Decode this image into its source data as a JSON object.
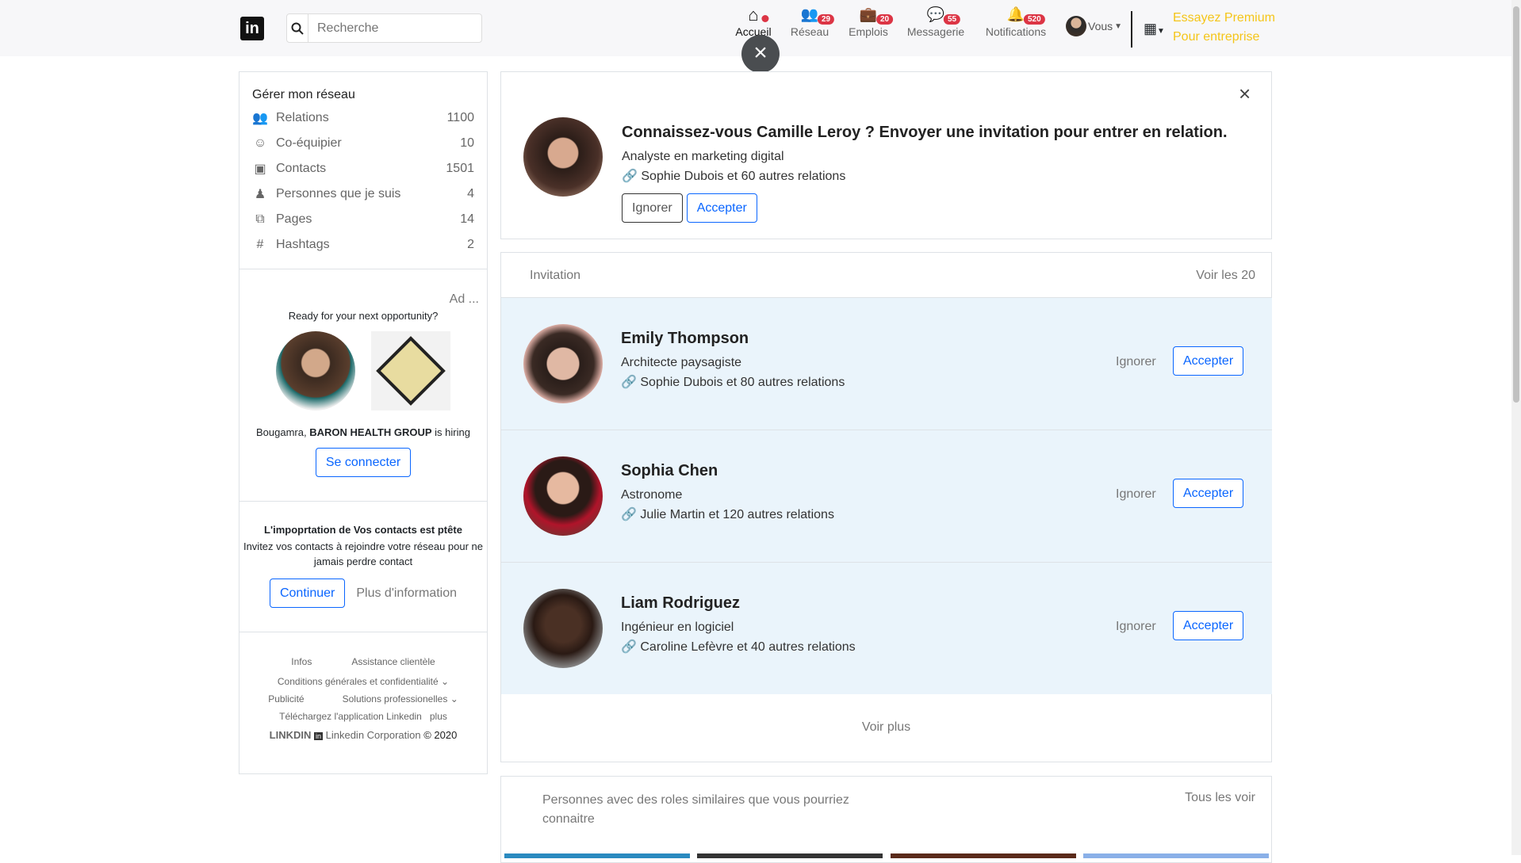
{
  "header": {
    "logo": "in",
    "search_placeholder": "Recherche",
    "nav": [
      {
        "label": "Accueil",
        "badge": ""
      },
      {
        "label": "Réseau",
        "badge": "29"
      },
      {
        "label": "Emplois",
        "badge": "20"
      },
      {
        "label": "Messagerie",
        "badge": "55"
      },
      {
        "label": "Notifications",
        "badge": "520"
      }
    ],
    "me": "Vous",
    "premium_1": "Essayez Premium",
    "premium_2": "Pour entreprise",
    "close": "×"
  },
  "sidebar": {
    "title": "Gérer mon réseau",
    "items": [
      {
        "label": "Relations",
        "count": "1100"
      },
      {
        "label": "Co-équipier",
        "count": "10"
      },
      {
        "label": "Contacts",
        "count": "1501"
      },
      {
        "label": "Personnes que je suis",
        "count": "4"
      },
      {
        "label": "Pages",
        "count": "14"
      },
      {
        "label": "Hashtags",
        "count": "2"
      }
    ],
    "ad": {
      "tag": "Ad ...",
      "headline": "Ready for your next opportunity?",
      "who": "Bougamra,",
      "company": "BARON HEALTH GROUP",
      "hiring": "is hiring",
      "button": "Se connecter"
    },
    "import": {
      "title": "L'impoprtation de Vos contacts est ptête",
      "text": "Invitez vos contacts à rejoindre votre réseau pour ne jamais perdre contact",
      "continue": "Continuer",
      "more": "Plus d'information"
    },
    "footer": {
      "infos": "Infos",
      "support": "Assistance clientèle",
      "terms": "Conditions générales et confidentialité",
      "ads": "Publicité",
      "solutions": "Solutions professionelles",
      "app": "Téléchargez l'application Linkedin",
      "plus": "plus",
      "brand": "LINKDIN",
      "corp": "Linkedin Corporation",
      "year": "© 2020"
    }
  },
  "suggestion": {
    "title": "Connaissez-vous Camille Leroy ? Envoyer une invitation pour entrer en relation.",
    "job": "Analyste en marketing digital",
    "mutual": "Sophie Dubois et 60 autres relations",
    "ignore": "Ignorer",
    "accept": "Accepter"
  },
  "invitations": {
    "header": "Invitation",
    "see_all": "Voir les 20",
    "items": [
      {
        "name": "Emily Thompson",
        "job": "Architecte paysagiste",
        "mutual": "Sophie Dubois et 80 autres relations"
      },
      {
        "name": "Sophia Chen",
        "job": "Astronome",
        "mutual": "Julie Martin et 120 autres relations"
      },
      {
        "name": "Liam Rodriguez",
        "job": "Ingénieur en logiciel",
        "mutual": "Caroline Lefèvre et 40 autres relations"
      }
    ],
    "ignore": "Ignorer",
    "accept": "Accepter",
    "more": "Voir plus"
  },
  "similar": {
    "title": "Personnes avec des roles similaires que vous pourriez connaitre",
    "see_all": "Tous les voir"
  }
}
